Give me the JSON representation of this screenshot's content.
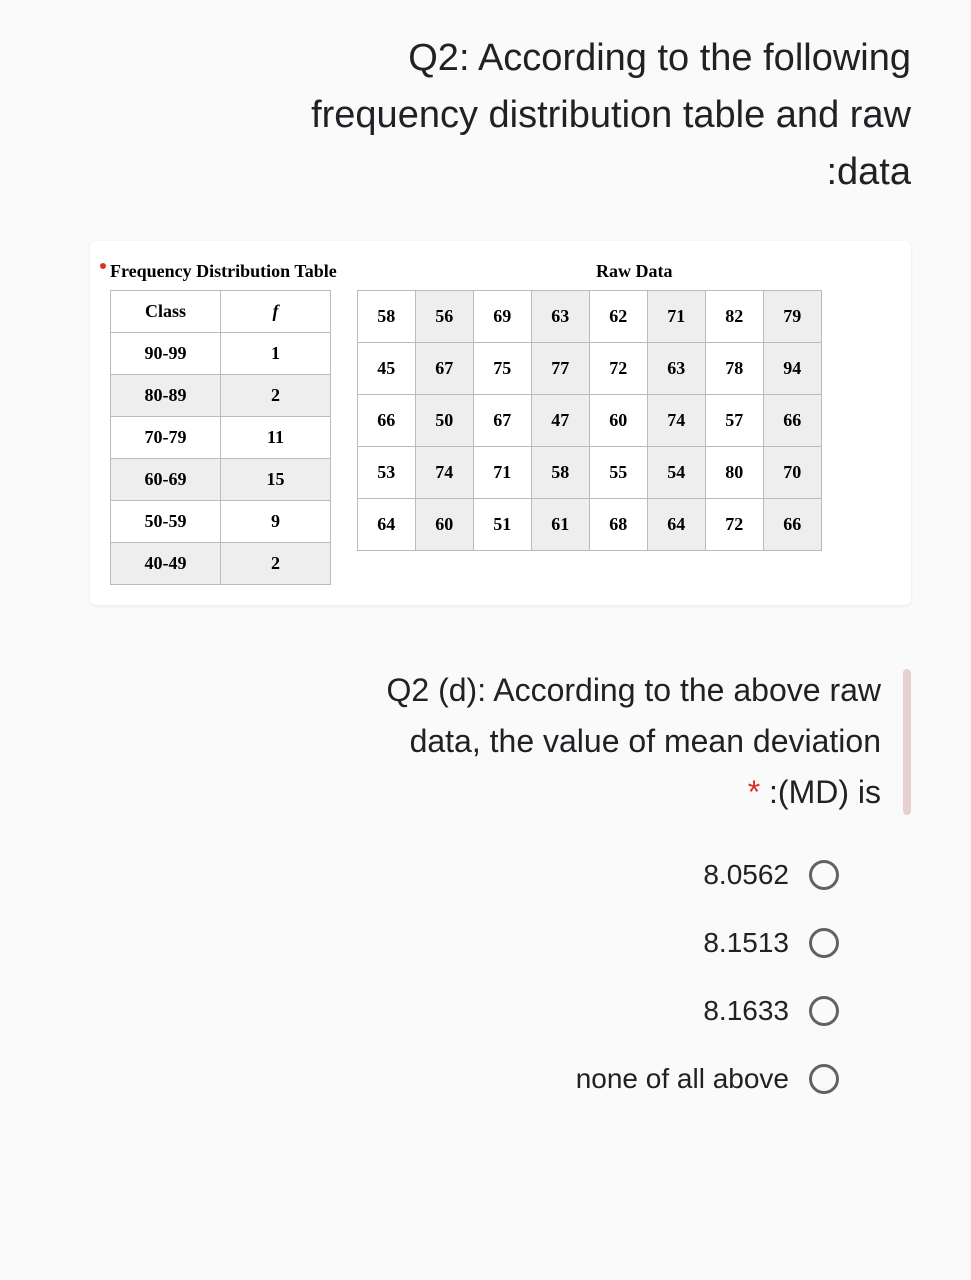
{
  "title_line1": "Q2: According to the following",
  "title_line2": "frequency distribution table and raw",
  "title_line3": ":data",
  "freq_section_title": "Frequency Distribution Table",
  "raw_section_title": "Raw Data",
  "freq_headers": {
    "class": "Class",
    "f": "f"
  },
  "freq_rows": [
    {
      "class": "90-99",
      "f": "1"
    },
    {
      "class": "80-89",
      "f": "2"
    },
    {
      "class": "70-79",
      "f": "11"
    },
    {
      "class": "60-69",
      "f": "15"
    },
    {
      "class": "50-59",
      "f": "9"
    },
    {
      "class": "40-49",
      "f": "2"
    }
  ],
  "raw_rows": [
    [
      "58",
      "56",
      "69",
      "63",
      "62",
      "71",
      "82",
      "79"
    ],
    [
      "45",
      "67",
      "75",
      "77",
      "72",
      "63",
      "78",
      "94"
    ],
    [
      "66",
      "50",
      "67",
      "47",
      "60",
      "74",
      "57",
      "66"
    ],
    [
      "53",
      "74",
      "71",
      "58",
      "55",
      "54",
      "80",
      "70"
    ],
    [
      "64",
      "60",
      "51",
      "61",
      "68",
      "64",
      "72",
      "66"
    ]
  ],
  "question2_line1": "Q2 (d): According to the above raw",
  "question2_line2": "data, the value of mean deviation",
  "question2_line3_prefix": "* ",
  "question2_line3": ":(MD) is",
  "options": [
    "8.0562",
    "8.1513",
    "8.1633",
    "none of all above"
  ]
}
